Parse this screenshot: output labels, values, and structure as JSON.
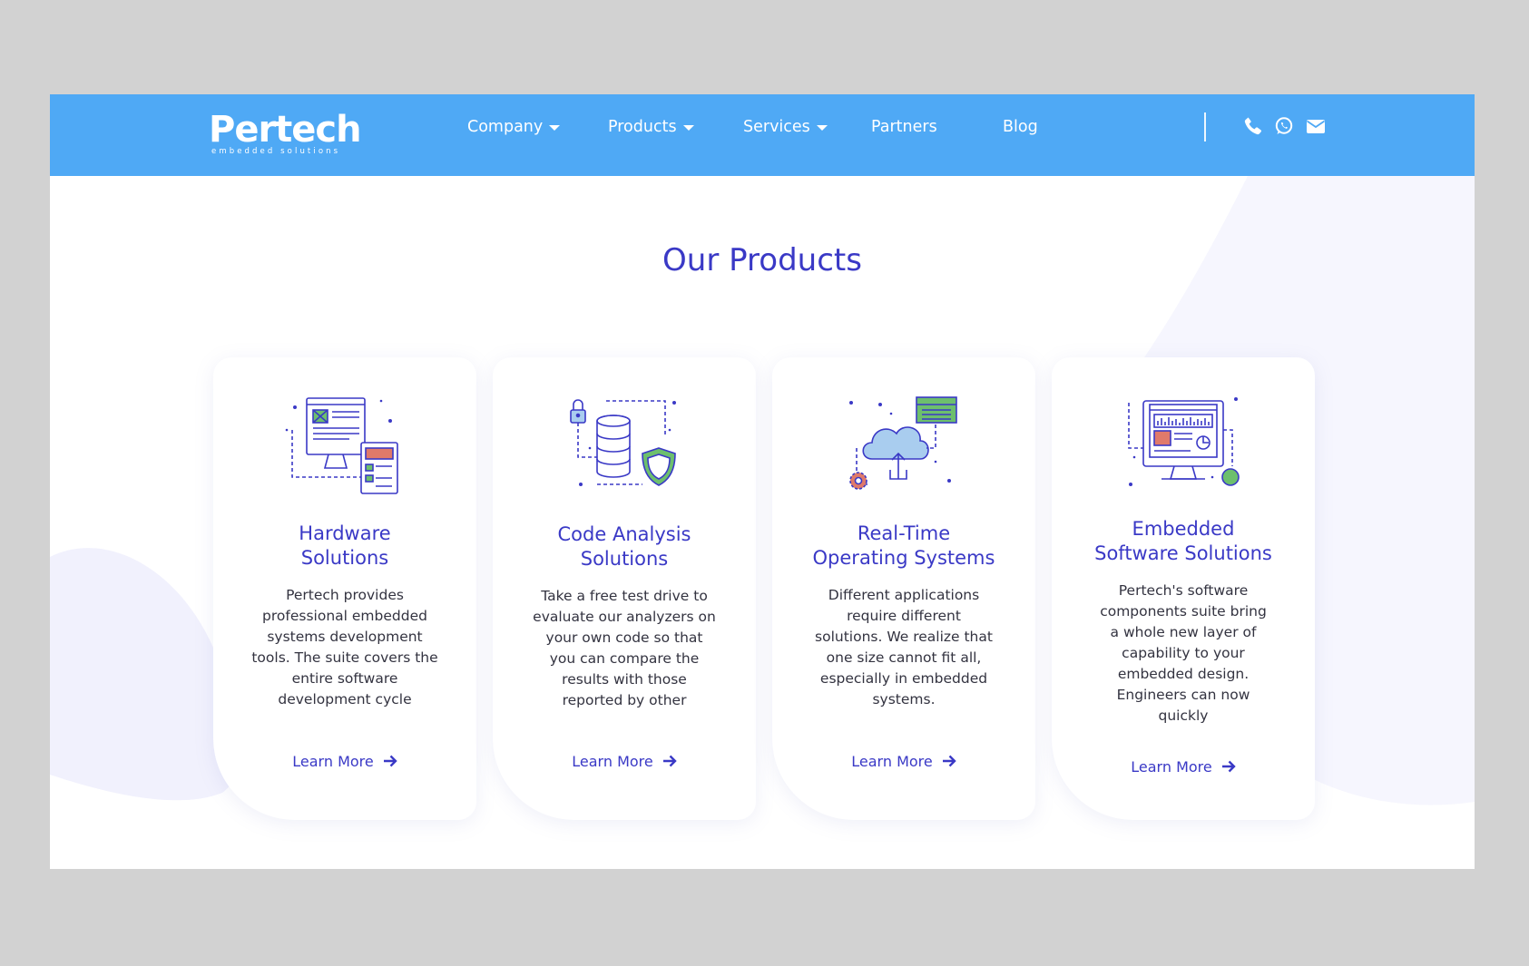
{
  "brand": {
    "name": "Pertech",
    "tagline": "embedded solutions"
  },
  "nav": [
    {
      "label": "Company",
      "has_dropdown": true
    },
    {
      "label": "Products",
      "has_dropdown": true
    },
    {
      "label": "Services",
      "has_dropdown": true
    },
    {
      "label": "Partners",
      "has_dropdown": false
    },
    {
      "label": "Blog",
      "has_dropdown": false
    }
  ],
  "contact_icons": [
    "phone-icon",
    "whatsapp-icon",
    "envelope-icon"
  ],
  "section": {
    "title": "Our Products"
  },
  "products": [
    {
      "icon": "hardware-monitor-icon",
      "title_line1": "Hardware",
      "title_line2": "Solutions",
      "description_lines": [
        "Pertech provides",
        "professional embedded",
        "systems development",
        "tools. The suite covers the",
        "entire software",
        "development cycle"
      ],
      "cta": "Learn More"
    },
    {
      "icon": "database-security-icon",
      "title_line1": "Code Analysis",
      "title_line2": "Solutions",
      "description_lines": [
        "Take a free test drive to",
        "evaluate our analyzers on",
        "your own code so that",
        "you can compare the",
        "results with those",
        "reported by other"
      ],
      "cta": "Learn More"
    },
    {
      "icon": "cloud-upload-icon",
      "title_line1": "Real-Time",
      "title_line2": "Operating Systems",
      "description_lines": [
        "Different applications",
        "require different",
        "solutions. We realize that",
        "one size cannot fit all,",
        "especially in embedded",
        "systems."
      ],
      "cta": "Learn More"
    },
    {
      "icon": "dashboard-monitor-icon",
      "title_line1": "Embedded",
      "title_line2": "Software Solutions",
      "description_lines": [
        "Pertech's software",
        "components suite bring",
        "a whole new layer of",
        "capability to your",
        "embedded design.",
        "Engineers can now",
        "quickly"
      ],
      "cta": "Learn More"
    }
  ],
  "colors": {
    "header_bg": "#4fa9f5",
    "accent": "#3a39c6",
    "text": "#333340",
    "page_bg": "#d2d2d2"
  }
}
